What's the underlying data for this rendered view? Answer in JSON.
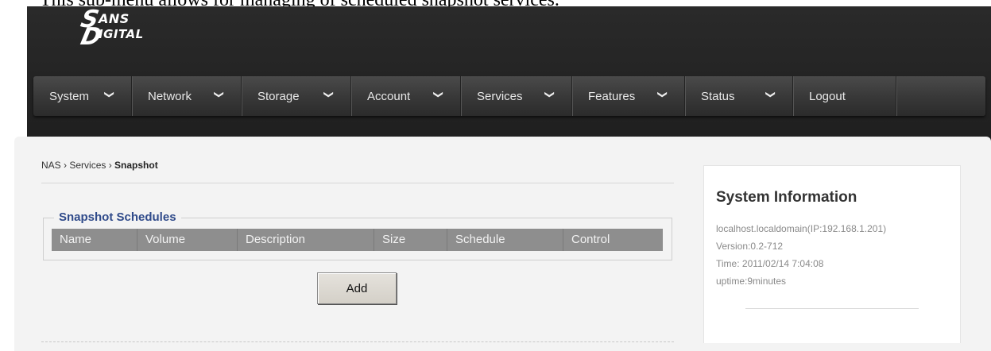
{
  "caption": "This sub-menu allows for managing of scheduled snapshot services.",
  "logo": {
    "line1": "ANS",
    "line2": "IGITAL",
    "big1": "S",
    "big2": "D"
  },
  "nav": [
    {
      "label": "System"
    },
    {
      "label": "Network"
    },
    {
      "label": "Storage"
    },
    {
      "label": "Account"
    },
    {
      "label": "Services"
    },
    {
      "label": "Features"
    },
    {
      "label": "Status"
    },
    {
      "label": "Logout"
    }
  ],
  "breadcrumb": {
    "part1": "NAS",
    "sep": " › ",
    "part2": "Services",
    "current": "Snapshot"
  },
  "schedules": {
    "legend": "Snapshot Schedules",
    "columns": [
      "Name",
      "Volume",
      "Description",
      "Size",
      "Schedule",
      "Control"
    ],
    "add_label": "Add"
  },
  "system_info": {
    "title": "System Information",
    "host": "localhost.localdomain(IP:192.168.1.201)",
    "version": "Version:0.2-712",
    "time": "Time: 2011/02/14 7:04:08",
    "uptime": "uptime:9minutes"
  },
  "colors": {
    "nav_bg": "#3a3a3a",
    "legend": "#2f4a8a",
    "table_head": "#8e8e8e"
  },
  "icons": {
    "nav_chevron": "chevron-down-icon"
  }
}
